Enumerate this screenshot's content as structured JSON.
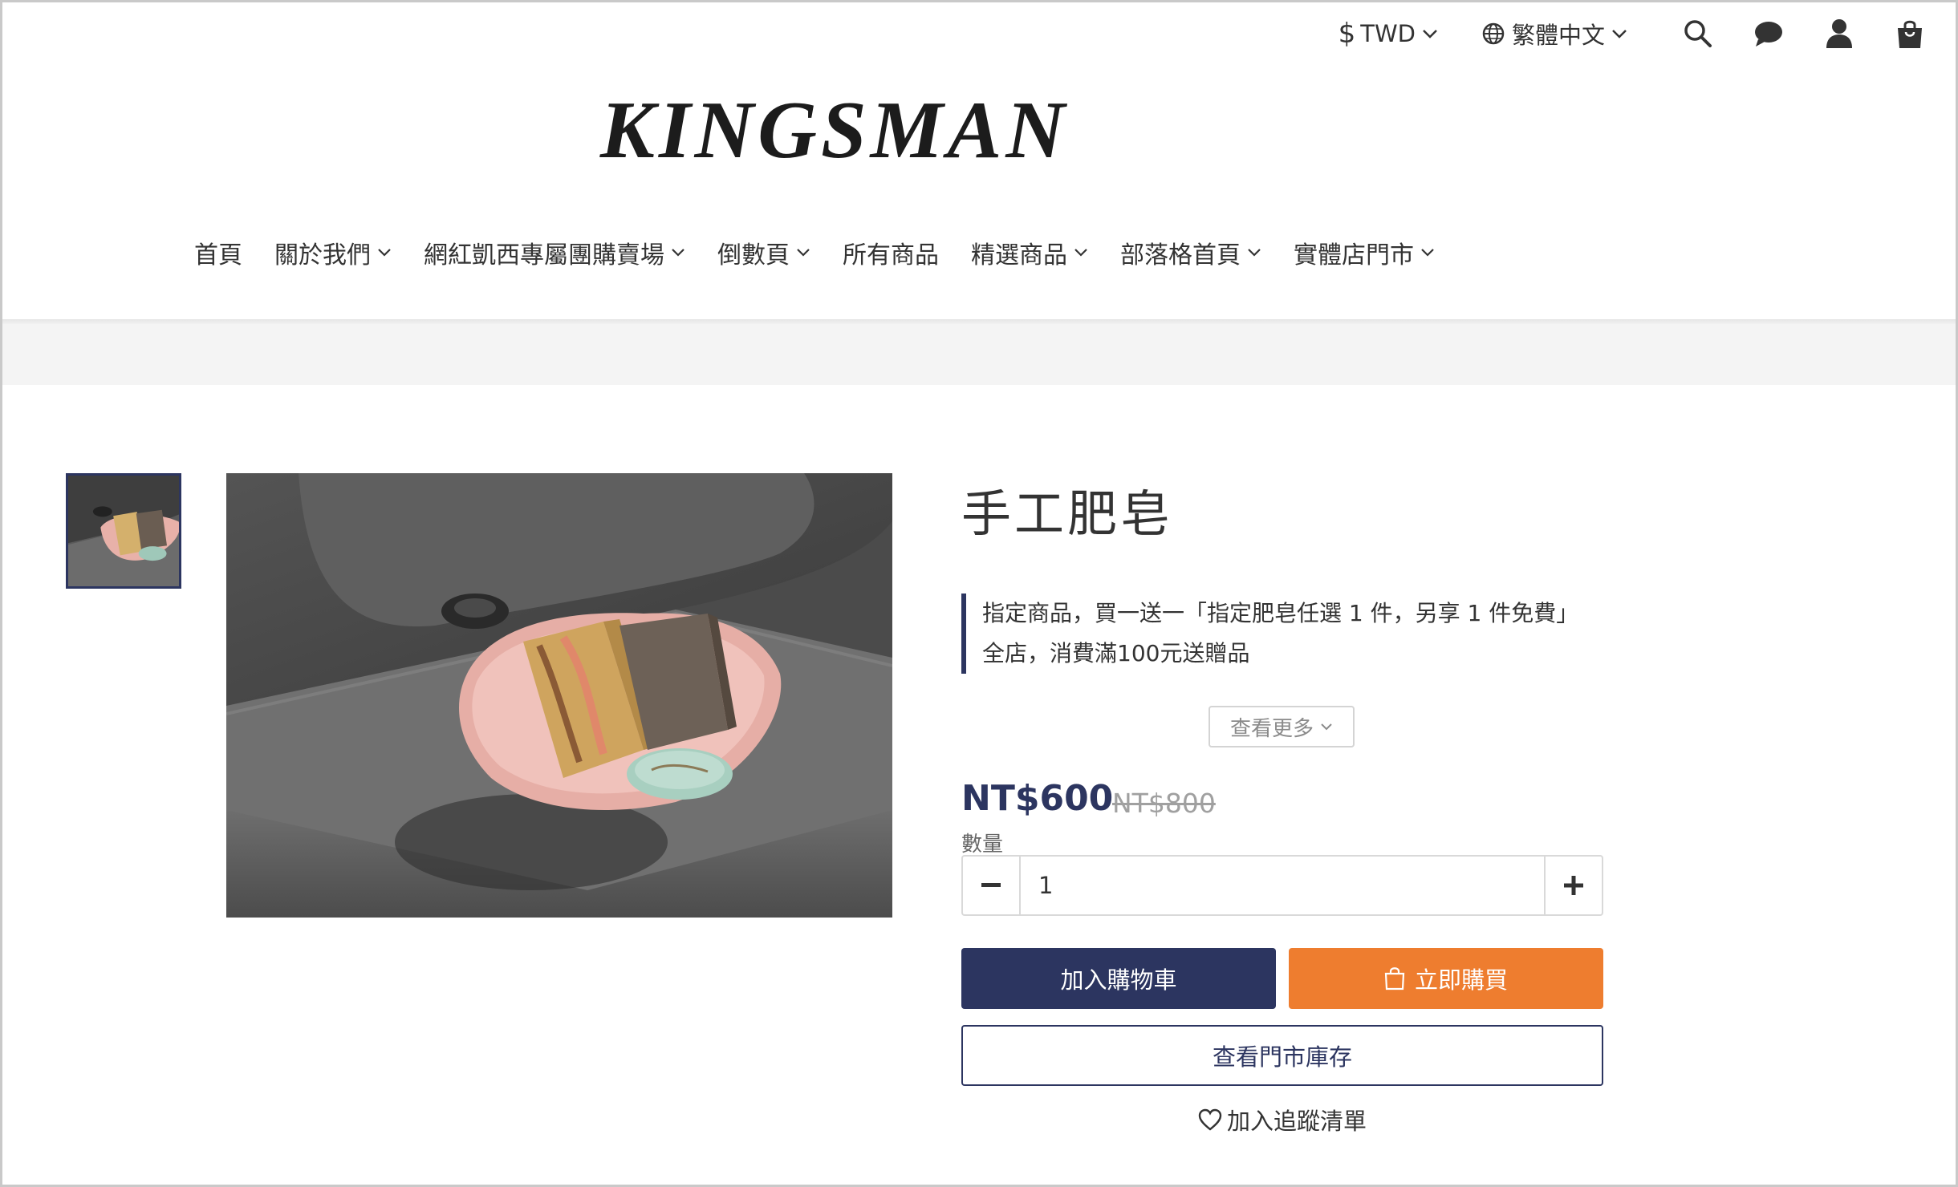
{
  "header": {
    "currency": {
      "symbol": "$",
      "label": "TWD"
    },
    "language": {
      "label": "繁體中文"
    },
    "icons": [
      "search-icon",
      "chat-icon",
      "user-icon",
      "cart-icon"
    ]
  },
  "logo": {
    "text": "KINGSMAN"
  },
  "nav": {
    "items": [
      {
        "label": "首頁",
        "dropdown": false
      },
      {
        "label": "關於我們",
        "dropdown": true
      },
      {
        "label": "網紅凱西專屬團購賣場",
        "dropdown": true
      },
      {
        "label": "倒數頁",
        "dropdown": true
      },
      {
        "label": "所有商品",
        "dropdown": false
      },
      {
        "label": "精選商品",
        "dropdown": true
      },
      {
        "label": "部落格首頁",
        "dropdown": true
      },
      {
        "label": "實體店門市",
        "dropdown": true
      }
    ]
  },
  "product": {
    "title": "手工肥皂",
    "promotions": [
      "指定商品，買一送一「指定肥皂任選 1 件，另享 1 件免費」",
      "全店，消費滿100元送贈品"
    ],
    "see_more": "查看更多",
    "price": "NT$600",
    "original_price": "NT$800",
    "quantity_label": "數量",
    "quantity": "1",
    "add_to_cart": "加入購物車",
    "buy_now": "立即購買",
    "check_stock": "查看門市庫存",
    "wishlist": "加入追蹤清單"
  },
  "colors": {
    "primary": "#2c3560",
    "accent": "#ee7d2f",
    "banner": "#f4f4f4"
  }
}
